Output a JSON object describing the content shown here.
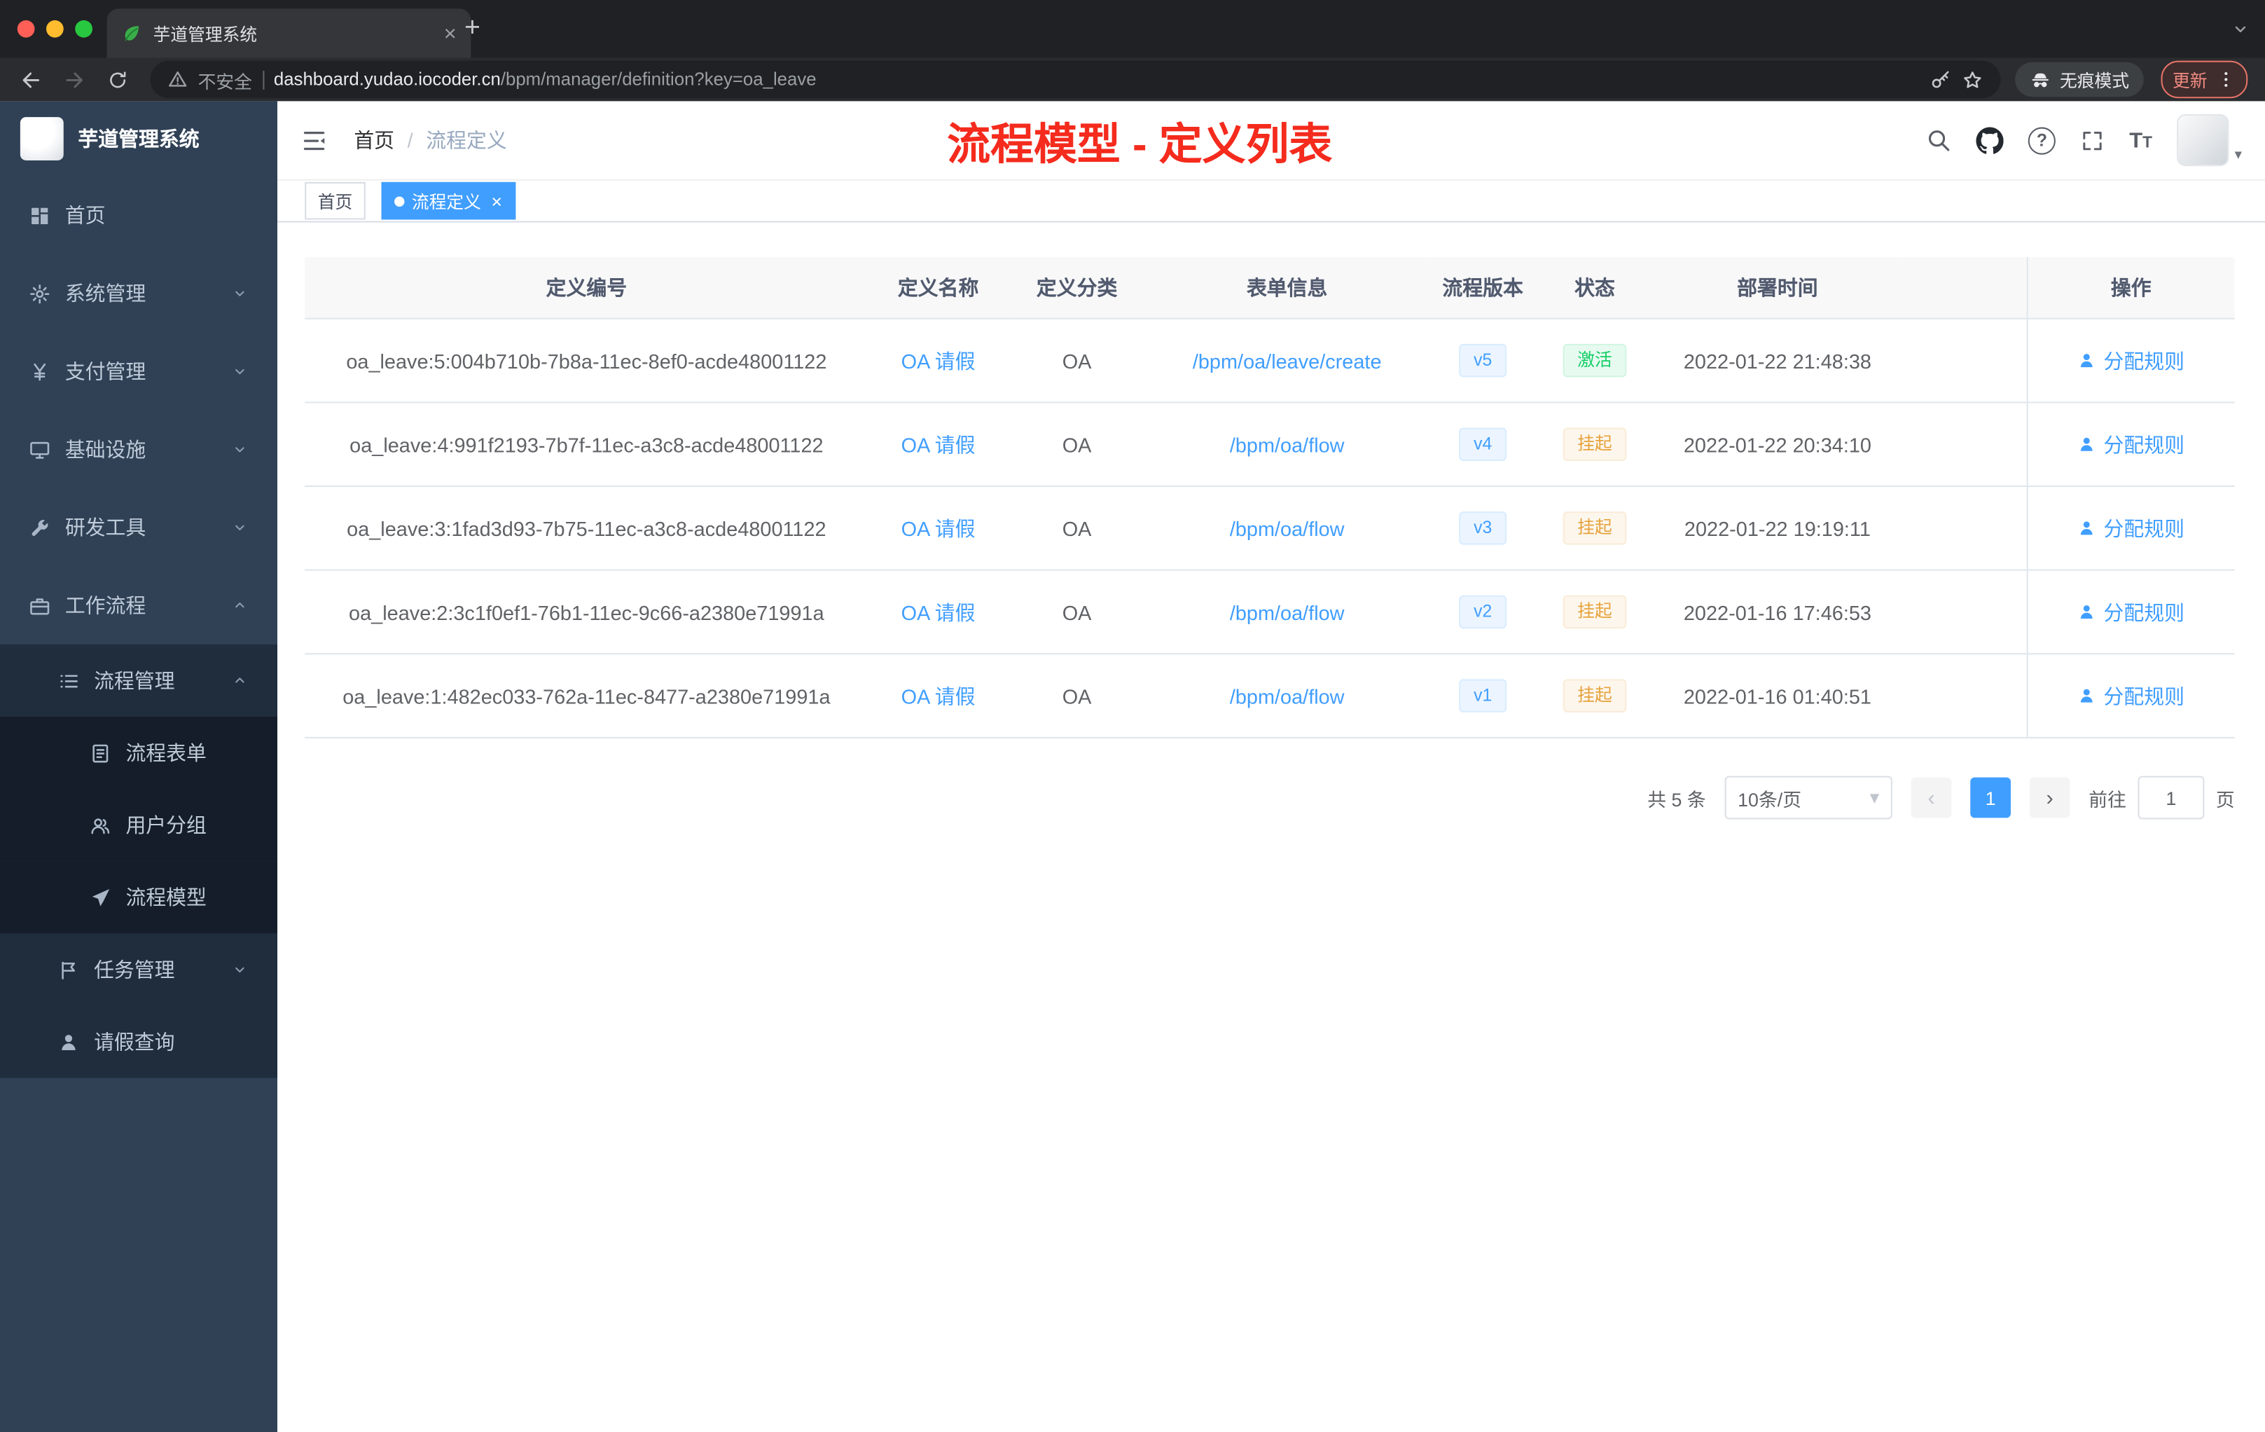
{
  "colors": {
    "accent": "#409eff",
    "annotation_red": "#f42b1d",
    "success_green": "#13ce66",
    "warning_orange": "#e6a23c",
    "sidebar_bg": "#304156",
    "submenu_bg": "#1f2d3d"
  },
  "browser": {
    "tab_title": "芋道管理系统",
    "security_label": "不安全",
    "url_host": "dashboard.yudao.iocoder.cn",
    "url_path": "/bpm/manager/definition?key=oa_leave",
    "incognito_label": "无痕模式",
    "update_label": "更新",
    "icons": [
      "leaf-favicon-icon",
      "close-icon",
      "new-tab-plus-icon",
      "back-icon",
      "forward-icon",
      "reload-icon",
      "warning-icon",
      "key-icon",
      "star-icon",
      "incognito-icon",
      "kebab-menu-icon",
      "chevron-down-icon"
    ]
  },
  "sidebar": {
    "logo_title": "芋道管理系统",
    "items": [
      {
        "label": "首页",
        "icon": "dashboard-icon",
        "level": 0
      },
      {
        "label": "系统管理",
        "icon": "gear-icon",
        "level": 0,
        "state": "collapsed"
      },
      {
        "label": "支付管理",
        "icon": "yen-icon",
        "level": 0,
        "state": "collapsed"
      },
      {
        "label": "基础设施",
        "icon": "monitor-icon",
        "level": 0,
        "state": "collapsed"
      },
      {
        "label": "研发工具",
        "icon": "wrench-icon",
        "level": 0,
        "state": "collapsed"
      },
      {
        "label": "工作流程",
        "icon": "briefcase-icon",
        "level": 0,
        "state": "expanded"
      },
      {
        "label": "流程管理",
        "icon": "list-icon",
        "level": 1,
        "state": "expanded"
      },
      {
        "label": "流程表单",
        "icon": "document-icon",
        "level": 2
      },
      {
        "label": "用户分组",
        "icon": "users-icon",
        "level": 2
      },
      {
        "label": "流程模型",
        "icon": "paper-plane-icon",
        "level": 2
      },
      {
        "label": "任务管理",
        "icon": "flag-icon",
        "level": 1,
        "state": "collapsed"
      },
      {
        "label": "请假查询",
        "icon": "person-icon",
        "level": 1
      }
    ]
  },
  "header": {
    "breadcrumb_home": "首页",
    "breadcrumb_separator": "/",
    "breadcrumb_current": "流程定义",
    "annotation": "流程模型 - 定义列表",
    "icons": [
      "menu-fold-icon",
      "search-icon",
      "github-icon",
      "question-icon",
      "fullscreen-icon",
      "font-size-icon",
      "avatar",
      "caret-down-icon"
    ]
  },
  "tags_view": {
    "home": "首页",
    "active": "流程定义"
  },
  "table": {
    "columns": [
      "定义编号",
      "定义名称",
      "定义分类",
      "表单信息",
      "流程版本",
      "状态",
      "部署时间",
      "操作"
    ],
    "rows": [
      {
        "id": "oa_leave:5:004b710b-7b8a-11ec-8ef0-acde48001122",
        "name": "OA 请假",
        "category": "OA",
        "form": "/bpm/oa/leave/create",
        "version": "v5",
        "status": "激活",
        "status_type": "success",
        "time": "2022-01-22 21:48:38",
        "action": "分配规则"
      },
      {
        "id": "oa_leave:4:991f2193-7b7f-11ec-a3c8-acde48001122",
        "name": "OA 请假",
        "category": "OA",
        "form": "/bpm/oa/flow",
        "version": "v4",
        "status": "挂起",
        "status_type": "warning",
        "time": "2022-01-22 20:34:10",
        "action": "分配规则"
      },
      {
        "id": "oa_leave:3:1fad3d93-7b75-11ec-a3c8-acde48001122",
        "name": "OA 请假",
        "category": "OA",
        "form": "/bpm/oa/flow",
        "version": "v3",
        "status": "挂起",
        "status_type": "warning",
        "time": "2022-01-22 19:19:11",
        "action": "分配规则"
      },
      {
        "id": "oa_leave:2:3c1f0ef1-76b1-11ec-9c66-a2380e71991a",
        "name": "OA 请假",
        "category": "OA",
        "form": "/bpm/oa/flow",
        "version": "v2",
        "status": "挂起",
        "status_type": "warning",
        "time": "2022-01-16 17:46:53",
        "action": "分配规则"
      },
      {
        "id": "oa_leave:1:482ec033-762a-11ec-8477-a2380e71991a",
        "name": "OA 请假",
        "category": "OA",
        "form": "/bpm/oa/flow",
        "version": "v1",
        "status": "挂起",
        "status_type": "warning",
        "time": "2022-01-16 01:40:51",
        "action": "分配规则"
      }
    ]
  },
  "pagination": {
    "total": "共 5 条",
    "page_size": "10条/页",
    "current_page": "1",
    "goto_label": "前往",
    "goto_value": "1",
    "page_unit": "页"
  }
}
